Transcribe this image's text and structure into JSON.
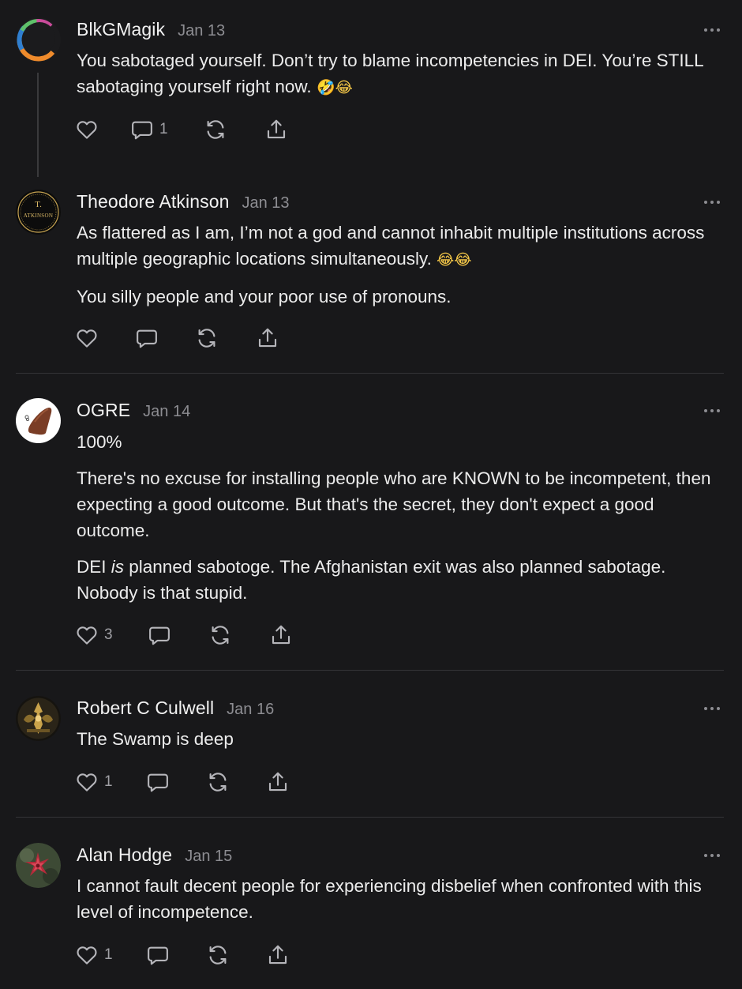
{
  "comments": [
    {
      "author": "BlkGMagik",
      "date": "Jan 13",
      "paragraphs": [
        "You sabotaged yourself. Don’t try to blame incompetencies in DEI. You’re STILL sabotaging yourself right now."
      ],
      "emoji": "🤣😂",
      "likes": "",
      "replies": "1",
      "avatar": "avatar-ring-icon"
    },
    {
      "author": "Theodore Atkinson",
      "date": "Jan 13",
      "paragraphs": [
        "As flattered as I am, I’m not a god and cannot inhabit multiple institutions across multiple geographic locations simultaneously.",
        "You silly people and your poor use of pronouns."
      ],
      "emoji": "😂😂",
      "likes": "",
      "replies": "",
      "avatar_text": {
        "top": "T.",
        "bottom": "ATKINSON"
      }
    },
    {
      "author": "OGRE",
      "date": "Jan 14",
      "paragraphs": [
        "100%",
        "There's no excuse for installing people who are KNOWN to be incompetent, then expecting a good outcome. But that's the secret, they don't expect a good outcome."
      ],
      "p3": {
        "pre": "DEI ",
        "em": "is",
        "post": " planned sabotoge. The Afghanistan exit was also planned sabotage. Nobody is that stupid."
      },
      "likes": "3",
      "replies": "",
      "avatar": "brown-object-icon"
    },
    {
      "author": "Robert C Culwell",
      "date": "Jan 16",
      "paragraphs": [
        "The Swamp is deep"
      ],
      "likes": "1",
      "replies": "",
      "avatar": "ornate-emblem-icon"
    },
    {
      "author": "Alan Hodge",
      "date": "Jan 15",
      "paragraphs": [
        "I cannot fault decent people for experiencing disbelief when confronted with this level of incompetence."
      ],
      "likes": "1",
      "replies": "",
      "avatar": "red-flower-icon"
    }
  ],
  "colors": {
    "background": "#18181a",
    "text": "#ececec",
    "muted": "#8d8d92",
    "divider": "#333336"
  },
  "icons": [
    "heart-icon",
    "comment-icon",
    "restack-icon",
    "share-icon",
    "more-icon"
  ]
}
